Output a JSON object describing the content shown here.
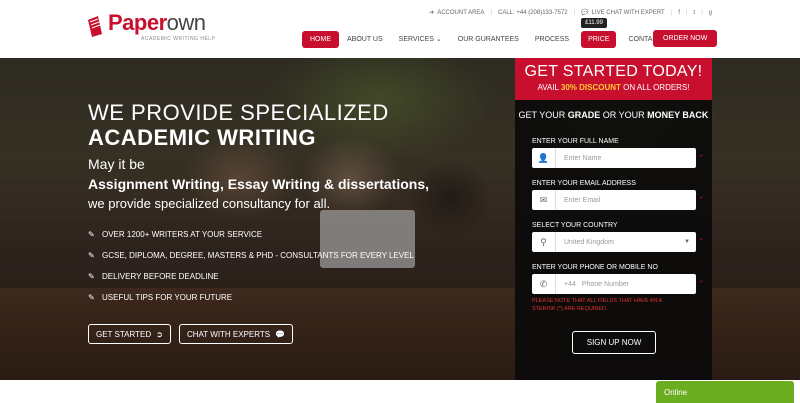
{
  "brand": {
    "name_part1": "Paper",
    "name_part2": "own",
    "tagline": "ACADEMIC WRITING HELP",
    "accent": "#c8102e"
  },
  "utility": {
    "account": "ACCOUNT AREA",
    "call": "CALL: +44 (208)133-7572",
    "chat": "LIVE CHAT WITH EXPERT",
    "social": [
      "f",
      "t",
      "g"
    ]
  },
  "nav": {
    "items": [
      "HOME",
      "ABOUT US",
      "SERVICES",
      "OUR GURANTEES",
      "PROCESS"
    ],
    "price_label": "PRICE",
    "price_tag": "£11.99",
    "contact": "CONTACT US",
    "order": "ORDER NOW"
  },
  "hero": {
    "line1": "WE PROVIDE SPECIALIZED",
    "line2": "ACADEMIC WRITING",
    "sub1": "May it be",
    "sub2": "Assignment Writing, Essay Writing & dissertations,",
    "sub3": "we provide specialized consultancy for all.",
    "features": [
      "OVER 1200+ WRITERS AT YOUR SERVICE",
      "GCSE, DIPLOMA, DEGREE, MASTERS & PHD - CONSULTANTS FOR EVERY LEVEL",
      "DELIVERY BEFORE DEADLINE",
      "USEFUL TIPS FOR YOUR FUTURE"
    ],
    "btn_started": "GET STARTED",
    "btn_chat": "CHAT WITH EXPERTS"
  },
  "form": {
    "title": "GET STARTED TODAY!",
    "avail_pre": "AVAIL ",
    "avail_bold": "30% DISCOUNT",
    "avail_post": " ON ALL ORDERS!",
    "money_pre": "GET YOUR ",
    "money_grade": "GRADE",
    "money_mid": " OR YOUR ",
    "money_back": "MONEY BACK",
    "name_label": "ENTER YOUR FULL NAME",
    "name_placeholder": "Enter Name",
    "email_label": "ENTER YOUR EMAIL ADDRESS",
    "email_placeholder": "Enter Email",
    "country_label": "SELECT YOUR COUNTRY",
    "country_value": "United Kingdom",
    "phone_label": "ENTER YOUR PHONE OR MOBILE NO",
    "phone_code": "+44",
    "phone_placeholder": "Phone Number",
    "note": "PLEASE NOTE THAT ALL FIELDS THAT HAVE AN A STERISK (*) ARE REQUIRED.",
    "signup": "SIGN UP NOW"
  },
  "chat": {
    "status": "Online",
    "color": "#6aad1e"
  }
}
